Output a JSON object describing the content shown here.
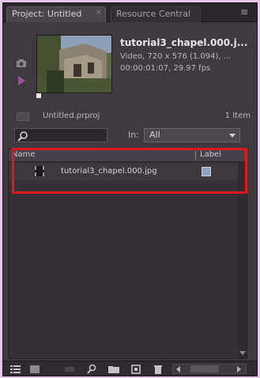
{
  "tabs": [
    {
      "label": "Project: Untitled",
      "close": "×",
      "active": true
    },
    {
      "label": "Resource Central",
      "active": false
    }
  ],
  "panel_menu_icon": "panel-menu-icon",
  "preview": {
    "clip_name": "tutorial3_chapel.000.j...",
    "meta_line1": "Video, 720 x 576 (1.094), ...",
    "meta_line2": "00:00:01:07, 29.97 fps"
  },
  "project": {
    "name": "Untitled.prproj",
    "item_count": "1 Item"
  },
  "search": {
    "placeholder": "",
    "in_label": "In:",
    "in_value": "All"
  },
  "list": {
    "columns": {
      "name": "Name",
      "label": "Label"
    },
    "rows": [
      {
        "name": "tutorial3_chapel.000.jpg",
        "label_color": "#8fa3c2"
      }
    ]
  },
  "colors": {
    "highlight": "#e0191f",
    "background": "#e6c9e6",
    "panel": "#3f3a40",
    "play_accent": "#9a549f"
  },
  "toolbar": {
    "icons": [
      "list-view-icon",
      "icon-view-icon",
      "automate-icon",
      "find-icon",
      "new-bin-icon",
      "new-item-icon",
      "delete-icon"
    ]
  }
}
